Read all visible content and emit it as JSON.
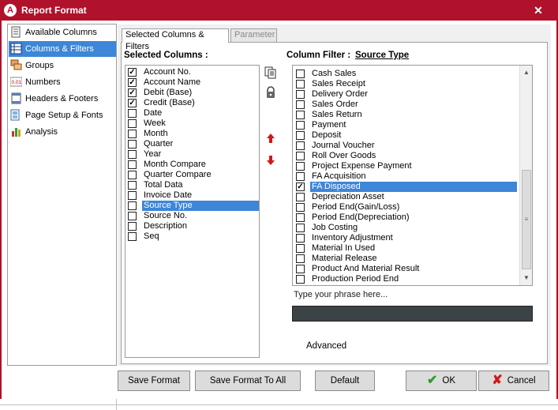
{
  "window": {
    "title": "Report Format",
    "app_icon": "A",
    "close_glyph": "✕"
  },
  "nav": [
    {
      "label": "Available Columns",
      "icon": "document-icon"
    },
    {
      "label": "Columns & Filters",
      "icon": "columns-icon",
      "selected": true
    },
    {
      "label": "Groups",
      "icon": "groups-icon"
    },
    {
      "label": "Numbers",
      "icon": "numbers-icon"
    },
    {
      "label": "Headers & Footers",
      "icon": "headers-icon"
    },
    {
      "label": "Page Setup & Fonts",
      "icon": "page-setup-icon"
    },
    {
      "label": "Analysis",
      "icon": "chart-icon"
    }
  ],
  "tabs": [
    {
      "label": "Selected Columns & Filters",
      "active": true
    },
    {
      "label": "Parameter",
      "active": false
    }
  ],
  "selected_columns": {
    "header": "Selected Columns :",
    "items": [
      {
        "label": "Account No.",
        "checked": true
      },
      {
        "label": "Account Name",
        "checked": true
      },
      {
        "label": "Debit (Base)",
        "checked": true
      },
      {
        "label": "Credit (Base)",
        "checked": true
      },
      {
        "label": "Date",
        "checked": false
      },
      {
        "label": "Week",
        "checked": false
      },
      {
        "label": "Month",
        "checked": false
      },
      {
        "label": "Quarter",
        "checked": false
      },
      {
        "label": "Year",
        "checked": false
      },
      {
        "label": "Month Compare",
        "checked": false
      },
      {
        "label": "Quarter Compare",
        "checked": false
      },
      {
        "label": "Total Data",
        "checked": false
      },
      {
        "label": "Invoice Date",
        "checked": false
      },
      {
        "label": "Source Type",
        "checked": false,
        "selected": true
      },
      {
        "label": "Source No.",
        "checked": false
      },
      {
        "label": "Description",
        "checked": false
      },
      {
        "label": "Seq",
        "checked": false
      }
    ]
  },
  "column_filter": {
    "header": "Column Filter :",
    "field": "Source Type",
    "items": [
      {
        "label": "Cash Sales",
        "checked": false
      },
      {
        "label": "Sales Receipt",
        "checked": false
      },
      {
        "label": "Delivery Order",
        "checked": false
      },
      {
        "label": "Sales Order",
        "checked": false
      },
      {
        "label": "Sales Return",
        "checked": false
      },
      {
        "label": "Payment",
        "checked": false
      },
      {
        "label": "Deposit",
        "checked": false
      },
      {
        "label": "Journal Voucher",
        "checked": false
      },
      {
        "label": "Roll Over Goods",
        "checked": false
      },
      {
        "label": "Project Expense Payment",
        "checked": false
      },
      {
        "label": "FA Acquisition",
        "checked": false
      },
      {
        "label": "FA Disposed",
        "checked": true,
        "selected": true
      },
      {
        "label": "Depreciation Asset",
        "checked": false
      },
      {
        "label": "Period End(Gain/Loss)",
        "checked": false
      },
      {
        "label": "Period End(Depreciation)",
        "checked": false
      },
      {
        "label": "Job Costing",
        "checked": false
      },
      {
        "label": "Inventory Adjustment",
        "checked": false
      },
      {
        "label": "Material In Used",
        "checked": false
      },
      {
        "label": "Material Release",
        "checked": false
      },
      {
        "label": "Product And Material Result",
        "checked": false
      },
      {
        "label": "Production Period End",
        "checked": false
      }
    ],
    "search_label": "Type your phrase here...",
    "search_value": ""
  },
  "advanced_label": "Advanced",
  "buttons": {
    "save_format": "Save Format",
    "save_format_all": "Save Format To All",
    "default": "Default",
    "ok": "OK",
    "cancel": "Cancel"
  },
  "colors": {
    "title_bar": "#b0112b",
    "selection": "#3d86d8",
    "search_box": "#3c4346"
  }
}
